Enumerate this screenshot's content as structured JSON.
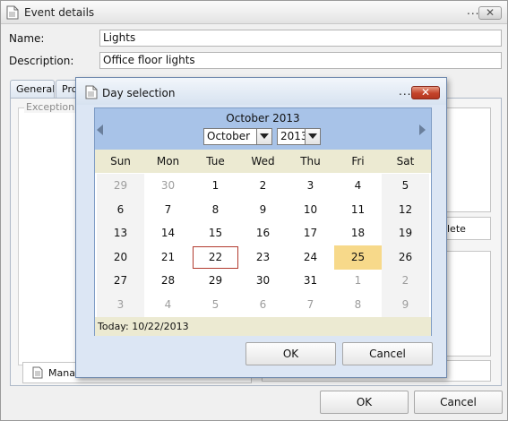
{
  "window": {
    "title": "Event details",
    "dots": "..."
  },
  "form": {
    "name_label": "Name:",
    "name_value": "Lights",
    "description_label": "Description:",
    "description_value": "Office floor lights"
  },
  "tabs": [
    {
      "label": "General"
    },
    {
      "label": "Pro"
    }
  ],
  "panel": {
    "exceptions_legend": "Exception",
    "manage_label": "Manag",
    "delete_label": "lete"
  },
  "footer": {
    "ok_label": "OK",
    "cancel_label": "Cancel"
  },
  "dialog": {
    "title": "Day selection",
    "dots": "...",
    "ok_label": "OK",
    "cancel_label": "Cancel"
  },
  "calendar": {
    "month_title": "October 2013",
    "month_select": "October",
    "year_select": "2013",
    "weekday_headers": [
      "Sun",
      "Mon",
      "Tue",
      "Wed",
      "Thu",
      "Fri",
      "Sat"
    ],
    "weeks": [
      [
        "29",
        "30",
        "1",
        "2",
        "3",
        "4",
        "5"
      ],
      [
        "6",
        "7",
        "8",
        "9",
        "10",
        "11",
        "12"
      ],
      [
        "13",
        "14",
        "15",
        "16",
        "17",
        "18",
        "19"
      ],
      [
        "20",
        "21",
        "22",
        "23",
        "24",
        "25",
        "26"
      ],
      [
        "27",
        "28",
        "29",
        "30",
        "31",
        "1",
        "2"
      ],
      [
        "3",
        "4",
        "5",
        "6",
        "7",
        "8",
        "9"
      ]
    ],
    "today_text": "Today: 10/22/2013",
    "today_day": "22",
    "selected_day": "25",
    "colors": {
      "header": "#a8c3e8",
      "weekday_bar": "#ecead2",
      "selected": "#f7d98a",
      "today_border": "#b23a2e",
      "close_button": "#c4432a"
    }
  }
}
